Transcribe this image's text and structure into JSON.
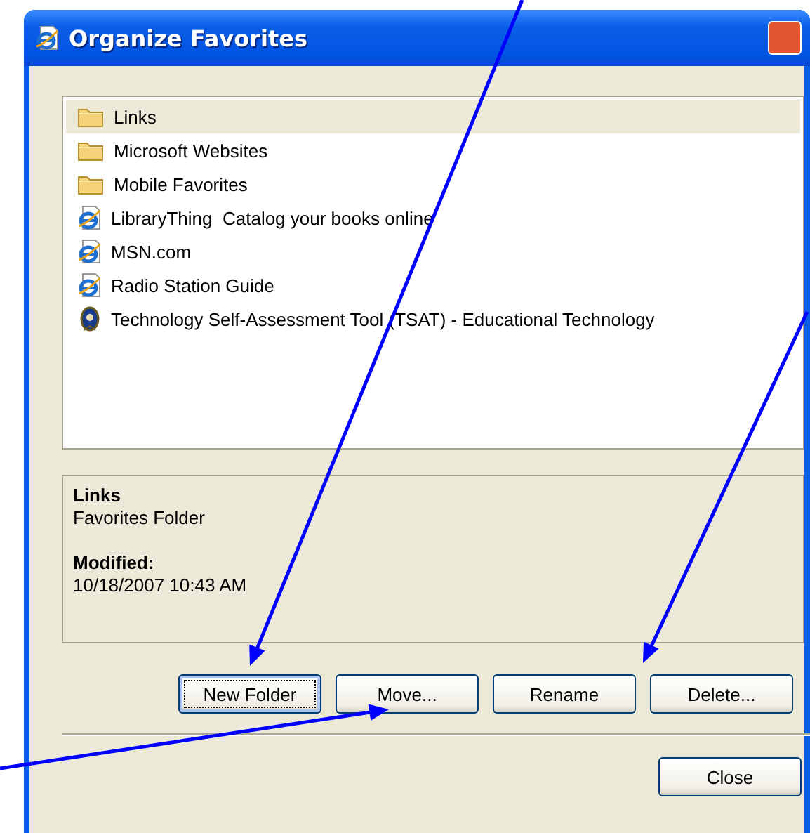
{
  "window": {
    "title": "Organize Favorites"
  },
  "favorites": [
    {
      "kind": "folder",
      "label": "Links",
      "selected": true
    },
    {
      "kind": "folder",
      "label": "Microsoft Websites",
      "selected": false
    },
    {
      "kind": "folder",
      "label": "Mobile Favorites",
      "selected": false
    },
    {
      "kind": "web",
      "label": "LibraryThing  Catalog your books online",
      "selected": false
    },
    {
      "kind": "web",
      "label": "MSN.com",
      "selected": false
    },
    {
      "kind": "web",
      "label": "Radio Station Guide",
      "selected": false
    },
    {
      "kind": "seal",
      "label": "Technology Self-Assessment Tool (TSAT) - Educational Technology",
      "selected": false
    }
  ],
  "details": {
    "name": "Links",
    "type": "Favorites Folder",
    "modified_label": "Modified:",
    "modified_value": "10/18/2007 10:43 AM"
  },
  "buttons": [
    {
      "label": "New Folder",
      "focused": true
    },
    {
      "label": "Move...",
      "focused": false
    },
    {
      "label": "Rename",
      "focused": false
    },
    {
      "label": "Delete...",
      "focused": false
    }
  ],
  "close_button": {
    "label": "Close"
  }
}
